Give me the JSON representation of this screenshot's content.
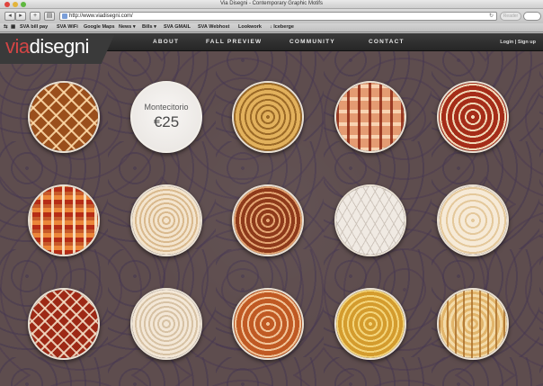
{
  "window": {
    "title": "Via Disegni - Contemporary Graphic Motifs"
  },
  "toolbar": {
    "url": "http://www.viadisegni.com/",
    "reader_label": "Reader"
  },
  "bookmarks": [
    "SVA bill pay",
    "SVA WiFi",
    "Google Maps",
    "News ▾",
    "Bills ▾",
    "SVA GMAIL",
    "SVA Webhost",
    "Lookwork",
    "↓ Iceberge"
  ],
  "site": {
    "logo_via": "via",
    "logo_disegni": "disegni",
    "nav": [
      "ABOUT",
      "FALL PREVIEW",
      "COMMUNITY",
      "CONTACT"
    ],
    "auth": {
      "login": "Login",
      "separator": " | ",
      "signup": "Sign up"
    },
    "hover_card": {
      "name": "Montecitorio",
      "price": "€25"
    }
  },
  "motifs": [
    {
      "pattern": "p1",
      "label": "brown-ogee-motif"
    },
    {
      "pattern": "p2",
      "label": "gold-lattice-motif"
    },
    {
      "pattern": "p3",
      "label": "coral-ogee-motif"
    },
    {
      "pattern": "p4",
      "label": "red-damask-motif"
    },
    {
      "pattern": "p5",
      "label": "red-ogee-motif"
    },
    {
      "pattern": "p6",
      "label": "cream-scroll-motif"
    },
    {
      "pattern": "p7",
      "label": "rust-damask-motif"
    },
    {
      "pattern": "p8",
      "label": "white-trellis-motif"
    },
    {
      "pattern": "p9",
      "label": "cream-damask-motif"
    },
    {
      "pattern": "p10",
      "label": "crimson-lattice-motif"
    },
    {
      "pattern": "p11",
      "label": "ivory-scroll-motif"
    },
    {
      "pattern": "p12",
      "label": "orange-medallion-motif"
    },
    {
      "pattern": "p13",
      "label": "mustard-damask-motif"
    },
    {
      "pattern": "p14",
      "label": "gold-trellis-motif"
    }
  ]
}
